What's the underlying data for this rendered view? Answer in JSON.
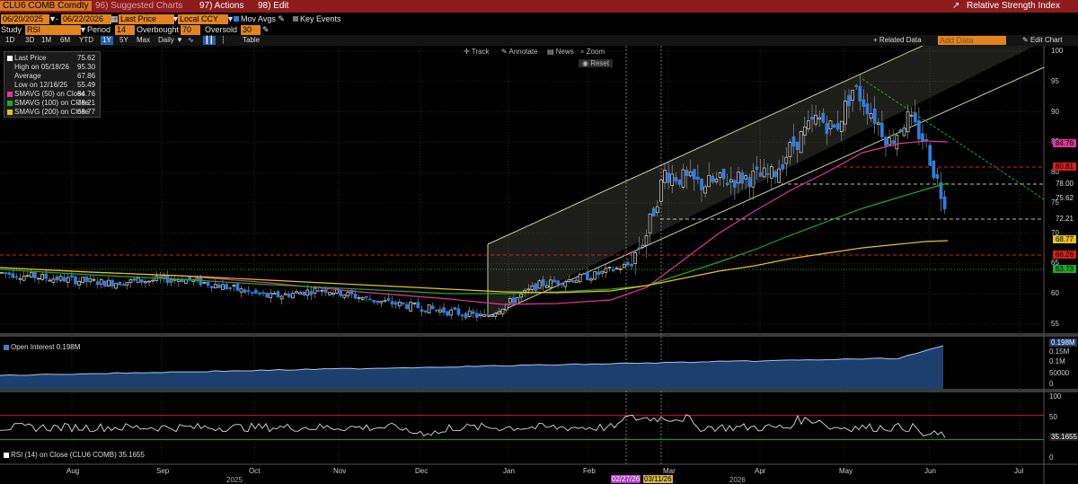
{
  "header": {
    "ticker": "CLU6 COMB Comdty",
    "suggested": "96) Suggested Charts",
    "actions": "97) Actions",
    "edit": "98) Edit",
    "title": "Relative Strength Index"
  },
  "controls": {
    "start_date": "06/20/2025",
    "end_date": "06/22/2026",
    "field": "Last Price",
    "currency": "Local CCY",
    "mov_avgs": "Mov Avgs",
    "key_events": "Key Events"
  },
  "study": {
    "label": "Study",
    "name": "RSI",
    "period_label": "Period",
    "period": "14",
    "overbought_label": "Overbought",
    "overbought": "70",
    "oversold_label": "Oversold",
    "oversold": "30"
  },
  "toolbar": {
    "ranges": [
      "1D",
      "3D",
      "1M",
      "6M",
      "YTD",
      "1Y",
      "5Y",
      "Max"
    ],
    "selected_range": "1Y",
    "frequency": "Daily",
    "table": "Table",
    "related": "+ Related Data",
    "add_data": "Add Data",
    "edit_chart": "Edit Chart"
  },
  "tools": {
    "track": "Track",
    "annotate": "Annotate",
    "news": "News",
    "zoom": "Zoom",
    "reset": "Reset"
  },
  "legend": {
    "last_price": {
      "label": "Last Price",
      "value": "75.62"
    },
    "high": {
      "label": "High on 05/18/26",
      "value": "95.30"
    },
    "average": {
      "label": "Average",
      "value": "67.86"
    },
    "low": {
      "label": "Low on 12/16/25",
      "value": "55.49"
    },
    "smavg50": {
      "label": "SMAVG (50)  on Close",
      "value": "84.76"
    },
    "smavg100": {
      "label": "SMAVG (100)  on Close",
      "value": "78.21"
    },
    "smavg200": {
      "label": "SMAVG (200)  on Close",
      "value": "68.77"
    }
  },
  "price_axis": [
    "100",
    "95",
    "90",
    "85",
    "80",
    "75",
    "70",
    "65",
    "60",
    "55"
  ],
  "price_tags": [
    {
      "text": "84.76",
      "color": "#e0359a"
    },
    {
      "text": "80.81",
      "color": "#d62020"
    },
    {
      "text": "78.00",
      "color": "#000000"
    },
    {
      "text": "75.62",
      "color": "#000000"
    },
    {
      "text": "72.21",
      "color": "#000000"
    },
    {
      "text": "68.77",
      "color": "#e8c21a"
    },
    {
      "text": "66.26",
      "color": "#d62020"
    },
    {
      "text": "63.73",
      "color": "#1ea82a"
    }
  ],
  "open_interest": {
    "label": "Open Interest 0.198M",
    "axis": [
      "0.198M",
      "0.15M",
      "0.1M",
      "50000",
      "0"
    ]
  },
  "rsi": {
    "label": "RSI (14)  on Close (CLU6 COMB) 35.1655",
    "axis": [
      "100",
      "50",
      "35.1655",
      "0"
    ]
  },
  "months": [
    "Aug",
    "Sep",
    "Oct",
    "Nov",
    "Dec",
    "Jan",
    "Feb",
    "Mar",
    "Apr",
    "May",
    "Jun",
    "Jul"
  ],
  "years": [
    "2025",
    "2026"
  ],
  "date_flags": [
    "02/27/26",
    "03/11/26"
  ],
  "colors": {
    "brand_bar": "#8e1b1e",
    "field_orange": "#e2841f",
    "candle_up": "#d9d9d9",
    "candle_down": "#2f7de1",
    "sma50": "#e0359a",
    "sma100": "#1ea82a",
    "sma200": "#e8c21a"
  }
}
